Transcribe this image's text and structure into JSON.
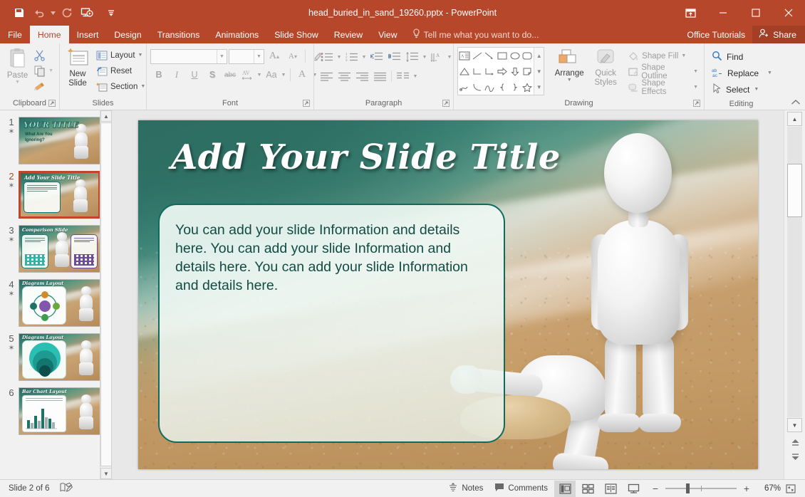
{
  "app": {
    "window_title": "head_buried_in_sand_19260.pptx - PowerPoint",
    "accent_color": "#b7472a"
  },
  "quick_access": {
    "items": [
      {
        "name": "save-icon",
        "label": "Save"
      },
      {
        "name": "undo-icon",
        "label": "Undo"
      },
      {
        "name": "redo-icon",
        "label": "Redo"
      },
      {
        "name": "start-presentation-icon",
        "label": "Start From Beginning"
      },
      {
        "name": "customize-qat-icon",
        "label": "Customize Quick Access Toolbar"
      }
    ]
  },
  "window_controls": {
    "ribbon_display": "Ribbon Display Options",
    "minimize": "Minimize",
    "restore": "Restore Down",
    "close": "Close"
  },
  "tabs": {
    "items": [
      {
        "label": "File",
        "active": false
      },
      {
        "label": "Home",
        "active": true
      },
      {
        "label": "Insert",
        "active": false
      },
      {
        "label": "Design",
        "active": false
      },
      {
        "label": "Transitions",
        "active": false
      },
      {
        "label": "Animations",
        "active": false
      },
      {
        "label": "Slide Show",
        "active": false
      },
      {
        "label": "Review",
        "active": false
      },
      {
        "label": "View",
        "active": false
      }
    ],
    "tell_me": "Tell me what you want to do...",
    "account": "Office Tutorials",
    "share": "Share"
  },
  "ribbon": {
    "clipboard": {
      "group_label": "Clipboard",
      "paste": "Paste",
      "cut": "Cut",
      "copy": "Copy",
      "format_painter": "Format Painter"
    },
    "slides": {
      "group_label": "Slides",
      "new_slide_line1": "New",
      "new_slide_line2": "Slide",
      "layout": "Layout",
      "reset": "Reset",
      "section": "Section"
    },
    "font": {
      "group_label": "Font",
      "font_name_value": "",
      "font_name_placeholder": "",
      "font_size_value": "",
      "font_size_placeholder": "",
      "increase_size": "A",
      "decrease_size": "A",
      "clear_formatting": "Clear All Formatting",
      "bold": "B",
      "italic": "I",
      "underline": "U",
      "shadow": "S",
      "strikethrough": "abc",
      "char_spacing": "AV",
      "change_case": "Aa",
      "font_color": "A"
    },
    "paragraph": {
      "group_label": "Paragraph",
      "bullets": "Bullets",
      "numbering": "Numbering",
      "decrease_indent": "Decrease List Level",
      "increase_indent": "Increase List Level",
      "line_spacing": "Line Spacing",
      "text_direction": "Text Direction",
      "align_text": "Align Text",
      "convert_smartart": "Convert to SmartArt",
      "align_left": "Align Left",
      "center": "Center",
      "align_right": "Align Right",
      "justify": "Justify",
      "columns": "Columns"
    },
    "drawing": {
      "group_label": "Drawing",
      "arrange": "Arrange",
      "quick_styles_line1": "Quick",
      "quick_styles_line2": "Styles",
      "shape_fill": "Shape Fill",
      "shape_outline": "Shape Outline",
      "shape_effects": "Shape Effects"
    },
    "editing": {
      "group_label": "Editing",
      "find": "Find",
      "replace": "Replace",
      "select": "Select"
    },
    "collapse": "Collapse the Ribbon"
  },
  "thumbnails": [
    {
      "number": "1",
      "title": "YOUR TITLE",
      "has_animation": true,
      "selected": false,
      "subtitle": "What Are You Ignoring?"
    },
    {
      "number": "2",
      "title": "Add Your Slide Title",
      "has_animation": true,
      "selected": true,
      "subtitle": ""
    },
    {
      "number": "3",
      "title": "Comparison Slide",
      "has_animation": true,
      "selected": false,
      "subtitle": ""
    },
    {
      "number": "4",
      "title": "Diagram Layout",
      "has_animation": true,
      "selected": false,
      "subtitle": ""
    },
    {
      "number": "5",
      "title": "Diagram Layout",
      "has_animation": true,
      "selected": false,
      "subtitle": ""
    },
    {
      "number": "6",
      "title": "Bar Chart Layout",
      "has_animation": true,
      "selected": false,
      "subtitle": ""
    }
  ],
  "slide": {
    "title": "Add Your Slide Title",
    "body": "You can add your slide Information and details here. You can add your slide Information and details here. You can add your slide Information and details here.",
    "title_color": "#ffffff",
    "body_color": "#124b42",
    "box_border_color": "#12695e"
  },
  "status_bar": {
    "slide_indicator": "Slide 2 of 6",
    "accessibility": "Accessibility Checker",
    "notes": "Notes",
    "comments": "Comments",
    "views": [
      {
        "name": "normal-view-button",
        "label": "Normal",
        "active": true
      },
      {
        "name": "slide-sorter-button",
        "label": "Slide Sorter",
        "active": false
      },
      {
        "name": "reading-view-button",
        "label": "Reading View",
        "active": false
      },
      {
        "name": "slide-show-button",
        "label": "Slide Show",
        "active": false
      }
    ],
    "zoom_out": "−",
    "zoom_in": "+",
    "zoom_level": "67%",
    "fit_to_window": "Fit slide to current window"
  }
}
